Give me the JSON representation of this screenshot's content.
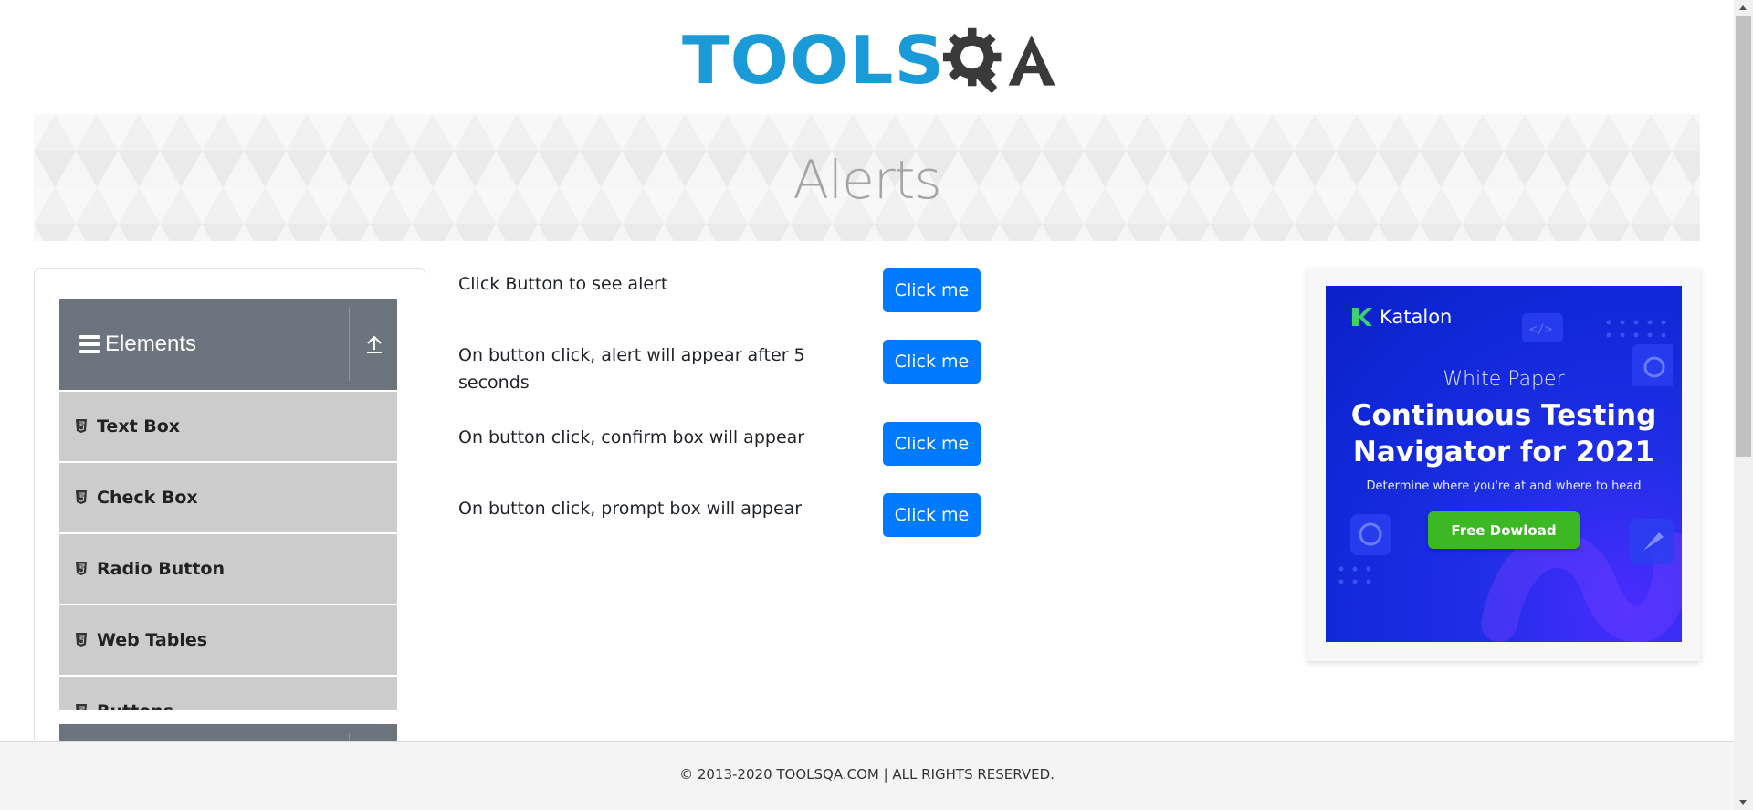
{
  "logo": {
    "text_tools": "TOOLS",
    "text_a": "A",
    "gear_icon": "gear-icon"
  },
  "banner": {
    "title": "Alerts"
  },
  "sidebar": {
    "group": {
      "title": "Elements",
      "menu_icon": "hamburger-icon",
      "collapse_icon": "upload-arrow-icon"
    },
    "items": [
      {
        "label": "Text Box",
        "icon": "html5-icon"
      },
      {
        "label": "Check Box",
        "icon": "html5-icon"
      },
      {
        "label": "Radio Button",
        "icon": "html5-icon"
      },
      {
        "label": "Web Tables",
        "icon": "html5-icon"
      },
      {
        "label": "Buttons",
        "icon": "html5-icon"
      }
    ]
  },
  "alerts": [
    {
      "text": "Click Button to see alert",
      "button": "Click me"
    },
    {
      "text": "On button click, alert will appear after 5 seconds",
      "button": "Click me"
    },
    {
      "text": "On button click, confirm box will appear",
      "button": "Click me"
    },
    {
      "text": "On button click, prompt box will appear",
      "button": "Click me"
    }
  ],
  "ad": {
    "brand": "Katalon",
    "eyebrow": "White Paper",
    "headline_line1": "Continuous Testing",
    "headline_line2": "Navigator for 2021",
    "subtext": "Determine where you're at and where to head",
    "cta": "Free Dowload"
  },
  "footer": {
    "text": "© 2013-2020 TOOLSQA.COM | ALL RIGHTS RESERVED."
  },
  "colors": {
    "primary": "#007bff",
    "sidebar_header": "#6c757d",
    "menu_item": "#cccccc",
    "logo_blue": "#1a9ad6",
    "ad_green": "#3cb825"
  }
}
